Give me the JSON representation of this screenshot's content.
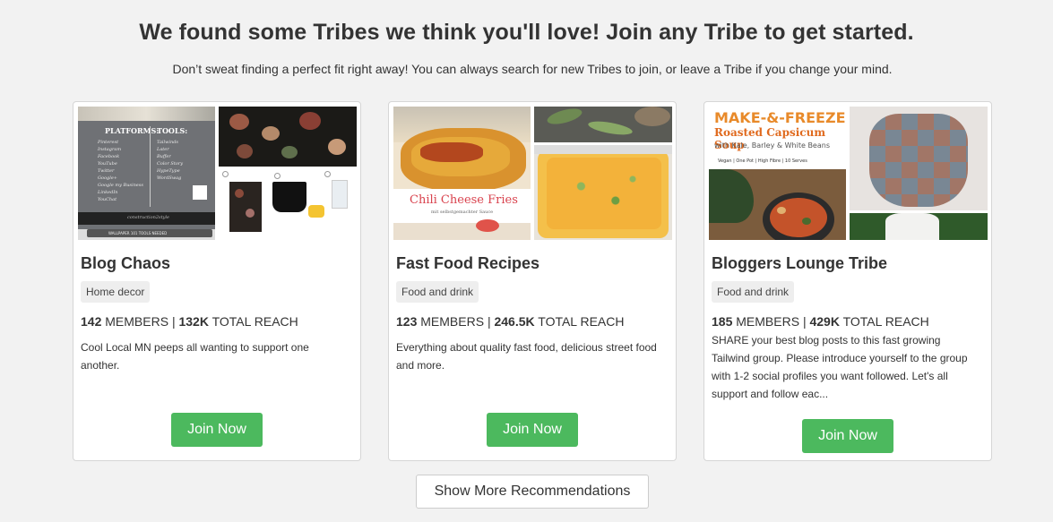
{
  "header": {
    "title": "We found some Tribes we think you'll love! Join any Tribe to get started.",
    "subtitle": "Don’t sweat finding a perfect fit right away! You can always search for new Tribes to join, or leave a Tribe if you change your mind."
  },
  "tribes": [
    {
      "name": "Blog Chaos",
      "category": "Home decor",
      "members": "142",
      "members_label": "MEMBERS",
      "reach": "132K",
      "reach_label": "TOTAL REACH",
      "description": "Cool Local MN peeps all wanting to support one another.",
      "join_label": "Join Now",
      "thumb_text": {
        "platforms": "PLATFORMS:",
        "tools": "TOOLS:",
        "platform_list": "Pinterest\nInstagram\nFacebook\nYouTube\nTwitter\nGoogle+\nGoogle my Business\nLinkedIn\nYouChat",
        "tool_list": "Tailwinds\nLater\nBuffer\nColor Story\nHypeType\nWordSwag",
        "credit": "construction2style",
        "banner": "WALLPAPER 101  TOOLS NEEDED"
      }
    },
    {
      "name": "Fast Food Recipes",
      "category": "Food and drink",
      "members": "123",
      "members_label": "MEMBERS",
      "reach": "246.5K",
      "reach_label": "TOTAL REACH",
      "description": "Everything about quality fast food, delicious street food and more.",
      "join_label": "Join Now",
      "thumb_text": {
        "dish": "Chili Cheese Fries",
        "sub": "mit selbstgemachter Sauce"
      }
    },
    {
      "name": "Bloggers Lounge Tribe",
      "category": "Food and drink",
      "members": "185",
      "members_label": "MEMBERS",
      "reach": "429K",
      "reach_label": "TOTAL REACH",
      "description": "SHARE your best blog posts to this fast growing Tailwind group. Please introduce yourself to the group with 1-2 social profiles you want followed. Let's all support and follow eac...",
      "join_label": "Join Now",
      "thumb_text": {
        "line1": "MAKE-&-FREEZE",
        "line2": "Roasted Capsicum Soup",
        "line3": "with Kale, Barley & White Beans",
        "line4": "Vegan | One Pot | High Fibre | 10 Serves"
      }
    }
  ],
  "show_more_label": "Show More Recommendations",
  "colors": {
    "join_button": "#4cb95e",
    "background": "#f2f2f2"
  }
}
